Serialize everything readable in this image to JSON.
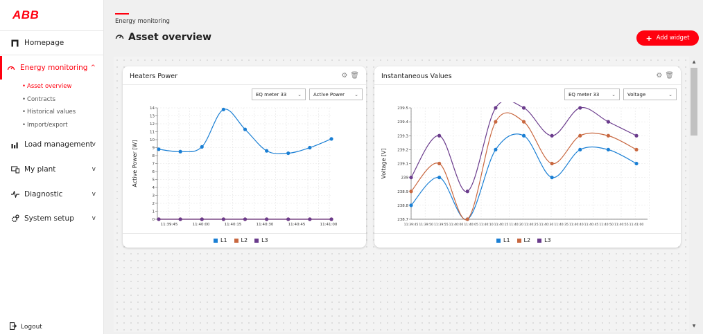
{
  "brand": {
    "logo_text": "ABB",
    "accent": "#ff000f"
  },
  "sidebar": {
    "items": [
      {
        "label": "Homepage",
        "icon": "home-icon"
      },
      {
        "label": "Energy monitoring",
        "icon": "gauge-icon",
        "active": true,
        "sub": [
          "Asset overview",
          "Contracts",
          "Historical values",
          "Import/export"
        ]
      },
      {
        "label": "Load management",
        "icon": "bar-chart-icon"
      },
      {
        "label": "My plant",
        "icon": "plant-icon"
      },
      {
        "label": "Diagnostic",
        "icon": "pulse-icon"
      },
      {
        "label": "System setup",
        "icon": "settings-icon"
      }
    ],
    "logout": "Logout"
  },
  "header": {
    "breadcrumb": "Energy monitoring",
    "title": "Asset overview",
    "add_widget": "Add widget"
  },
  "widgets": [
    {
      "title": "Heaters Power",
      "meter": "EQ meter 33",
      "measure": "Active Power"
    },
    {
      "title": "Instantaneous Values",
      "meter": "EQ meter 33",
      "measure": "Voltage"
    }
  ],
  "colors": {
    "L1": "#1a7fd4",
    "L2": "#c8673f",
    "L3": "#6a3b8c"
  },
  "chart_data": [
    {
      "type": "line",
      "ylabel": "Active Power [W]",
      "xlabel": "",
      "x": [
        "11:39:45",
        "11:39:52",
        "11:40:00",
        "11:40:07",
        "11:40:15",
        "11:40:22",
        "11:40:30",
        "11:40:37",
        "11:40:45",
        "11:40:52",
        "11:41:00"
      ],
      "xticks": [
        "11:39:45",
        "11:40:00",
        "11:40:15",
        "11:40:30",
        "11:40:45",
        "11:41:00"
      ],
      "yticks": [
        0,
        1,
        2,
        3,
        4,
        5,
        6,
        7,
        8,
        9,
        10,
        11,
        12,
        13,
        14
      ],
      "ylim": [
        0,
        14
      ],
      "series": [
        {
          "name": "L1",
          "values": [
            8.8,
            8.5,
            9.1,
            13.8,
            11.3,
            8.6,
            8.3,
            9.0,
            10.1
          ],
          "x_index": [
            0,
            1,
            2,
            3,
            4,
            5,
            6,
            7,
            8
          ]
        },
        {
          "name": "L2",
          "values": [
            0,
            0,
            0,
            0,
            0,
            0,
            0,
            0,
            0
          ]
        },
        {
          "name": "L3",
          "values": [
            0,
            0,
            0,
            0,
            0,
            0,
            0,
            0,
            0
          ]
        }
      ],
      "legend": "bottom",
      "grid": true
    },
    {
      "type": "line",
      "ylabel": "Voltage [V]",
      "xlabel": "",
      "x": [
        "11:39:45",
        "11:39:50",
        "11:39:55",
        "11:40:00",
        "11:40:05",
        "11:40:10",
        "11:40:15",
        "11:40:20",
        "11:40:25",
        "11:40:30",
        "11:40:35",
        "11:40:40",
        "11:40:45",
        "11:40:50",
        "11:40:55",
        "11:41:00"
      ],
      "yticks": [
        238.7,
        238.8,
        238.9,
        239.0,
        239.1,
        239.2,
        239.3,
        239.4,
        239.5
      ],
      "ylim": [
        238.7,
        239.5
      ],
      "series": [
        {
          "name": "L1",
          "values": [
            238.8,
            239.0,
            238.7,
            239.2,
            239.3,
            239.0,
            239.2,
            239.2,
            239.1
          ]
        },
        {
          "name": "L2",
          "values": [
            238.9,
            239.1,
            238.7,
            239.4,
            239.4,
            239.1,
            239.3,
            239.3,
            239.2
          ]
        },
        {
          "name": "L3",
          "values": [
            239.0,
            239.3,
            238.9,
            239.5,
            239.5,
            239.3,
            239.5,
            239.4,
            239.3
          ]
        }
      ],
      "legend": "bottom",
      "grid": true
    }
  ]
}
